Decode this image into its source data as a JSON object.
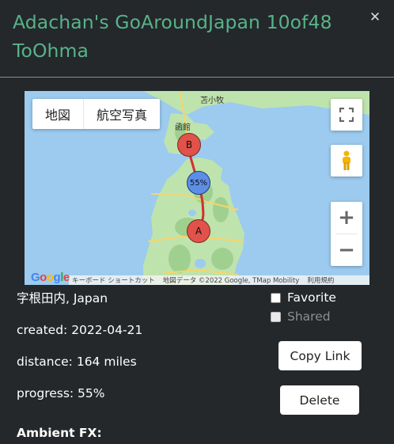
{
  "header": {
    "title": "Adachan's GoAroundJapan 10of48 ToOhma",
    "close_icon": "close-icon"
  },
  "map": {
    "type_map_label": "地図",
    "type_satellite_label": "航空写真",
    "marker_start": "A",
    "marker_end": "B",
    "marker_progress": "55%",
    "place_labels": [
      "苫小牧",
      "函館"
    ],
    "keyboard_shortcuts": "キーボード ショートカット",
    "map_data": "地図データ ©2022 Google, TMap Mobility",
    "terms": "利用規約",
    "google_logo": "Google",
    "colors": {
      "land": "#b8dfa6",
      "water": "#9ccbef",
      "route": "#d32f2f",
      "marker_red": "#e0524a",
      "marker_blue": "#5c8ee6"
    }
  },
  "details": {
    "location": "字根田内, Japan",
    "created": "created: 2022-04-21",
    "distance": "distance: 164 miles",
    "progress": "progress: 55%",
    "ambient_label": "Ambient FX:"
  },
  "options": {
    "favorite_label": "Favorite",
    "favorite_checked": false,
    "shared_label": "Shared",
    "shared_checked": false,
    "shared_disabled": true
  },
  "actions": {
    "copy_link_label": "Copy Link",
    "delete_label": "Delete"
  }
}
